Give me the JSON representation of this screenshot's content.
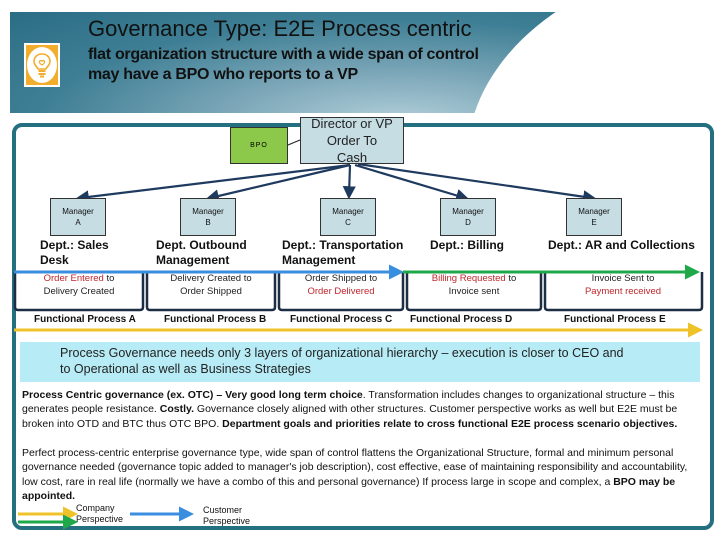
{
  "header": {
    "title": "Governance Type: E2E Process centric",
    "subtitle_line1": "flat organization structure with a wide span of control",
    "subtitle_line2": "may have a BPO who reports to a VP",
    "icon": "lightbulb-icon"
  },
  "org_chart": {
    "top": {
      "line1": "Director or VP",
      "line2": "Order To",
      "line3": "Cash"
    },
    "bpo": "BPO",
    "managers": [
      {
        "line1": "Manager",
        "line2": "A"
      },
      {
        "line1": "Manager",
        "line2": "B"
      },
      {
        "line1": "Manager",
        "line2": "C"
      },
      {
        "line1": "Manager",
        "line2": "D"
      },
      {
        "line1": "Manager",
        "line2": "E"
      }
    ]
  },
  "departments": [
    {
      "line1": "Dept.: Sales",
      "line2": "Desk"
    },
    {
      "line1": "Dept. Outbound",
      "line2": "Management"
    },
    {
      "line1": "Dept.: Transportation",
      "line2": "Management"
    },
    {
      "line1": "Dept.: Billing",
      "line2": ""
    },
    {
      "line1": "Dept.: AR and Collections",
      "line2": ""
    }
  ],
  "processes": [
    {
      "start": "Order Entered",
      "connector": " to",
      "end": "Delivery Created",
      "start_red": true,
      "end_red": false
    },
    {
      "start": "Delivery Created",
      "connector": " to",
      "end": "Order Shipped",
      "start_red": false,
      "end_red": false
    },
    {
      "start": "Order Shipped",
      "connector": " to",
      "end": "Order Delivered",
      "start_red": false,
      "end_red": true
    },
    {
      "start": "Billing Requested",
      "connector": " to",
      "end": "Invoice sent",
      "start_red": true,
      "end_red": false
    },
    {
      "start": "Invoice Sent",
      "connector": " to",
      "end": "Payment received",
      "start_red": false,
      "end_red": true
    }
  ],
  "functional_processes": [
    "Functional Process A",
    "Functional Process B",
    "Functional Process C",
    "Functional Process D",
    "Functional Process E"
  ],
  "callout": {
    "line1": "Process Governance needs only 3 layers of organizational hierarchy – execution is closer to CEO and",
    "line2": "to Operational as well as Business Strategies"
  },
  "paragraph1": {
    "b1": "Process Centric governance (ex. OTC) – Very good long term choice",
    "t1": ". Transformation includes changes to organizational structure – this generates people resistance. ",
    "b2": "Costly.",
    "t2": " Governance closely aligned with other structures. Customer perspective works as well but E2E must be broken into OTD and BTC thus OTC BPO. ",
    "b3": "Department goals and priorities relate to cross functional E2E process scenario objectives."
  },
  "paragraph2": {
    "t1": "Perfect process-centric enterprise governance type, wide span of control flattens the Organizational Structure, formal and minimum personal governance needed (governance topic added to manager's job description), cost effective, ease of maintaining responsibility and accountability, low cost, rare in real life (normally we have a combo of this and personal governance) If process large in scope and complex, a ",
    "b1": "BPO may be appointed."
  },
  "legend": {
    "company": {
      "line1": "Company",
      "line2": "Perspective"
    },
    "customer": {
      "line1": "Customer",
      "line2": "Perspective"
    }
  },
  "colors": {
    "frame": "#246f80",
    "customer_arrow_blue": "#3a8ee0",
    "customer_arrow_green": "#1ea84a",
    "company_arrow_yellow": "#f0c22a",
    "bpo_green": "#8cc94a",
    "box_fill": "#c6dde4",
    "callout_fill": "#b7ecf6",
    "highlight_red": "#c0262c"
  }
}
